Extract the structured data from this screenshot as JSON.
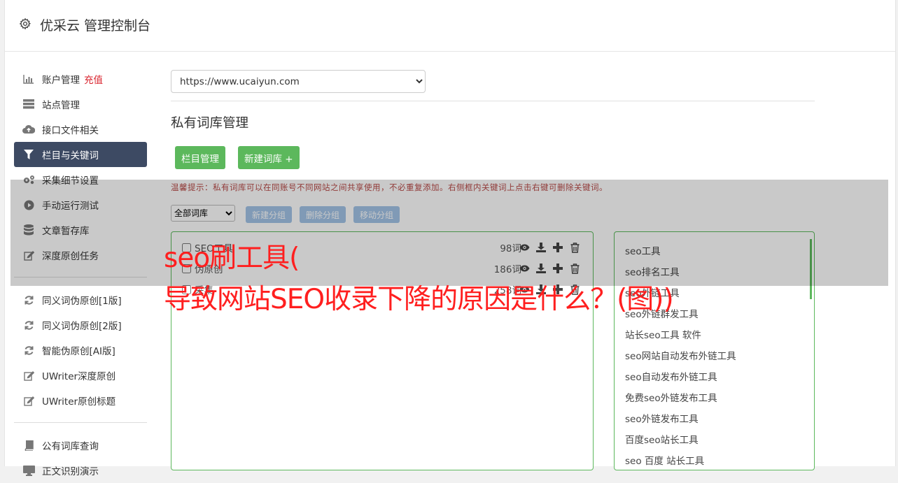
{
  "app_title": "优采云 管理控制台",
  "sidebar": {
    "group1": [
      {
        "label": "账户管理",
        "icon": "bar-chart-icon",
        "extra": "充值"
      },
      {
        "label": "站点管理",
        "icon": "server-icon"
      },
      {
        "label": "接口文件相关",
        "icon": "cloud-upload-icon"
      },
      {
        "label": "栏目与关键词",
        "icon": "filter-icon",
        "active": true
      },
      {
        "label": "采集细节设置",
        "icon": "gears-icon"
      },
      {
        "label": "手动运行测试",
        "icon": "play-circle-icon"
      },
      {
        "label": "文章暂存库",
        "icon": "database-icon"
      },
      {
        "label": "深度原创任务",
        "icon": "edit-icon"
      }
    ],
    "group2": [
      {
        "label": "同义词伪原创[1版]",
        "icon": "refresh-icon"
      },
      {
        "label": "同义词伪原创[2版]",
        "icon": "refresh-icon"
      },
      {
        "label": "智能伪原创[AI版]",
        "icon": "refresh-icon"
      },
      {
        "label": "UWriter深度原创",
        "icon": "edit-icon"
      },
      {
        "label": "UWriter原创标题",
        "icon": "edit-icon"
      }
    ],
    "group3": [
      {
        "label": "公有词库查询",
        "icon": "book-icon"
      },
      {
        "label": "正文识别演示",
        "icon": "monitor-icon"
      }
    ]
  },
  "main": {
    "site_select_value": "https://www.ucaiyun.com",
    "page_title": "私有词库管理",
    "btn_column_manage": "栏目管理",
    "btn_new_library": "新建词库 +",
    "tip": "温馨提示：私有词库可以在同账号不同网站之间共享使用，不必重复添加。右侧框内关键词上点击右键可删除关键词。",
    "library_select_value": "全部词库",
    "btn_new_group": "新建分组",
    "btn_delete_group": "删除分组",
    "btn_move_group": "移动分组",
    "groups": [
      {
        "name": "SEO工具",
        "count": "98词"
      },
      {
        "name": "伪原创",
        "count": "186词"
      },
      {
        "name": "采集",
        "count": "258词"
      }
    ],
    "keywords": [
      "seo工具",
      "seo排名工具",
      "seo外链工具",
      "seo外链群发工具",
      "站长seo工具 软件",
      "seo网站自动发布外链工具",
      "seo自动发布外链工具",
      "免费seo外链发布工具",
      "seo外链发布工具",
      "百度seo站长工具",
      "seo 百度 站长工具"
    ]
  },
  "overlay": {
    "line1": "seo刷工具(",
    "line2": "导致网站SEO收录下降的原因是什么？(图))"
  },
  "colors": {
    "accent_green": "#5cb85c",
    "active_nav": "#3d4a63",
    "charge_red": "#d9232d",
    "headline_red": "#ff1f1f",
    "disabled_blue": "#a3c4e7"
  }
}
